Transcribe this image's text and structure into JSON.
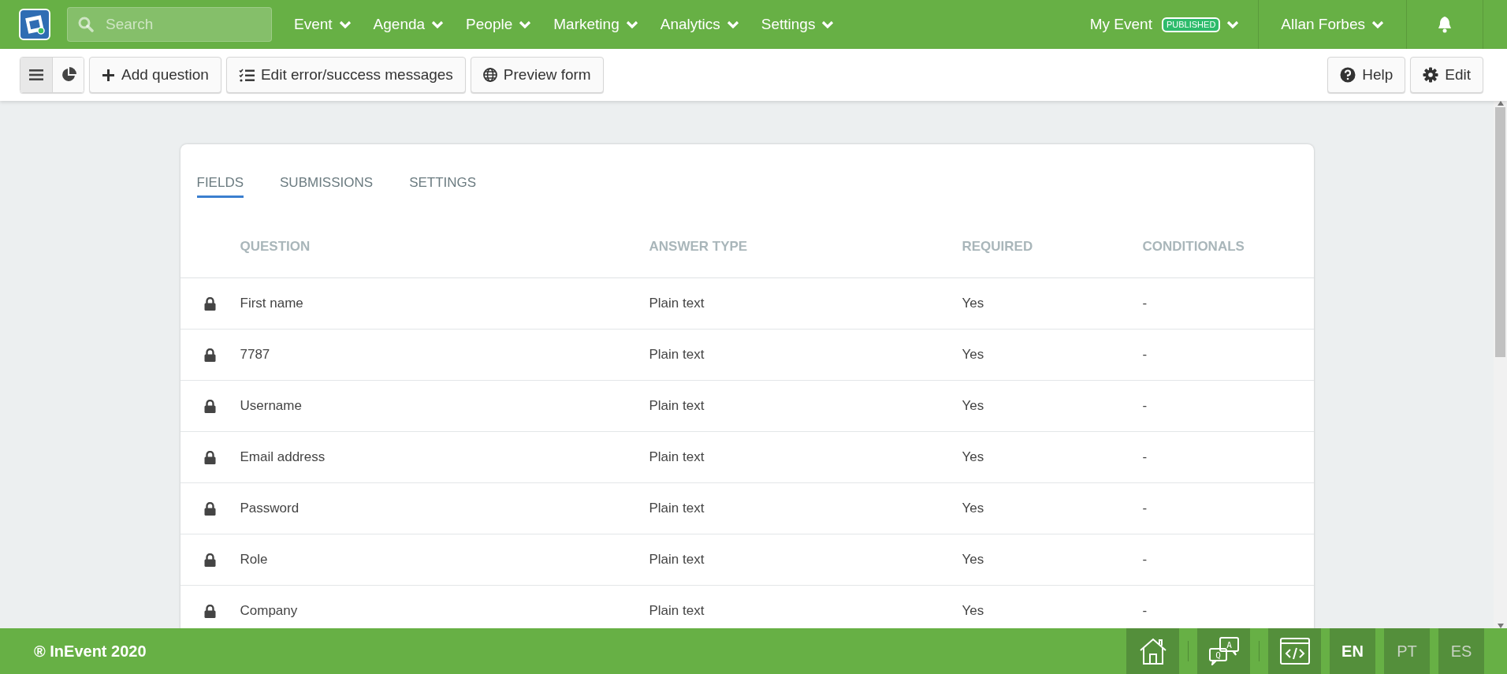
{
  "navbar": {
    "search": {
      "placeholder": "Search"
    },
    "menus": [
      {
        "label": "Event"
      },
      {
        "label": "Agenda"
      },
      {
        "label": "People"
      },
      {
        "label": "Marketing"
      },
      {
        "label": "Analytics"
      },
      {
        "label": "Settings"
      }
    ],
    "event": {
      "label": "My Event",
      "badge": "PUBLISHED"
    },
    "user": {
      "label": "Allan Forbes"
    }
  },
  "toolbar": {
    "views": [
      {
        "kind": "list",
        "selected": true
      },
      {
        "kind": "pie",
        "selected": false
      }
    ],
    "buttons": [
      {
        "kind": "plus",
        "label": "Add question"
      },
      {
        "kind": "checklist",
        "label": "Edit error/success messages"
      },
      {
        "kind": "globe",
        "label": "Preview form"
      }
    ],
    "right_buttons": [
      {
        "kind": "help",
        "label": "Help"
      },
      {
        "kind": "gear",
        "label": "Edit"
      }
    ]
  },
  "tabs": [
    {
      "label": "FIELDS",
      "selected": true
    },
    {
      "label": "SUBMISSIONS",
      "selected": false
    },
    {
      "label": "SETTINGS",
      "selected": false
    }
  ],
  "table": {
    "columns": [
      "QUESTION",
      "ANSWER TYPE",
      "REQUIRED",
      "CONDITIONALS"
    ],
    "rows": [
      {
        "locked": true,
        "cells": [
          "First name",
          "Plain text",
          "Yes",
          "-"
        ]
      },
      {
        "locked": true,
        "cells": [
          "7787",
          "Plain text",
          "Yes",
          "-"
        ]
      },
      {
        "locked": true,
        "cells": [
          "Username",
          "Plain text",
          "Yes",
          "-"
        ]
      },
      {
        "locked": true,
        "cells": [
          "Email address",
          "Plain text",
          "Yes",
          "-"
        ]
      },
      {
        "locked": true,
        "cells": [
          "Password",
          "Plain text",
          "Yes",
          "-"
        ]
      },
      {
        "locked": true,
        "cells": [
          "Role",
          "Plain text",
          "Yes",
          "-"
        ]
      },
      {
        "locked": true,
        "cells": [
          "Company",
          "Plain text",
          "Yes",
          "-"
        ]
      }
    ]
  },
  "footer": {
    "copyright": "® InEvent 2020",
    "tools": [
      {
        "kind": "home"
      },
      {
        "kind": "qa",
        "letters": [
          "A",
          "Q"
        ]
      },
      {
        "kind": "code"
      }
    ],
    "languages": [
      {
        "label": "EN",
        "selected": true
      },
      {
        "label": "PT",
        "selected": false
      },
      {
        "label": "ES",
        "selected": false
      }
    ]
  }
}
